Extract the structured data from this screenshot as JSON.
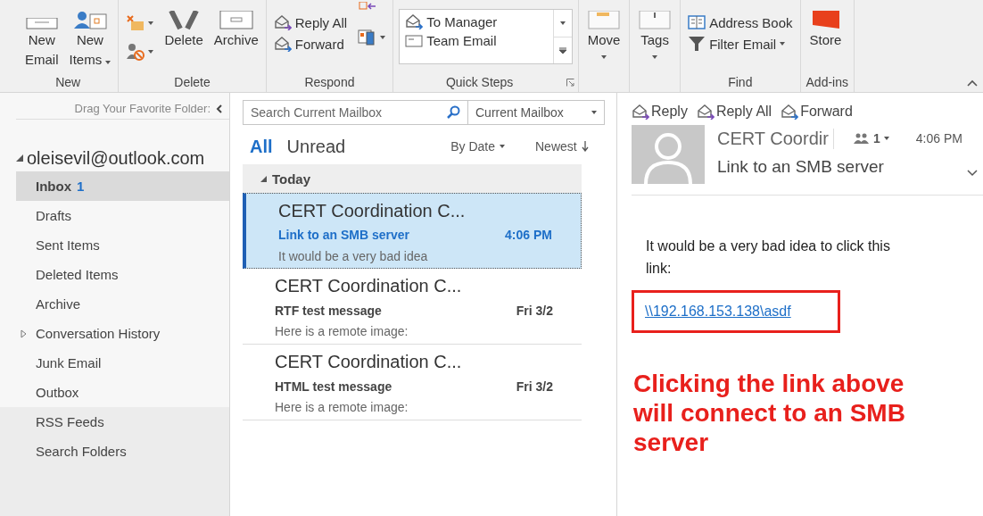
{
  "ribbon": {
    "groups": [
      {
        "label": "New",
        "buttons": [
          {
            "kind": "large",
            "lines": [
              "New",
              "Email"
            ],
            "dropdown": false
          },
          {
            "kind": "large",
            "lines": [
              "New",
              "Items"
            ],
            "dropdown": true
          }
        ]
      },
      {
        "label": "Delete",
        "buttons": [
          {
            "kind": "icons",
            "dropdown": true
          },
          {
            "kind": "large",
            "lines": [
              "Delete"
            ],
            "dropdown": false
          },
          {
            "kind": "large",
            "lines": [
              "Archive"
            ],
            "dropdown": false
          }
        ]
      },
      {
        "label": "Respond",
        "buttons": [
          {
            "kind": "small",
            "lines": [
              "Reply All"
            ],
            "dropdown": false
          },
          {
            "kind": "small",
            "lines": [
              "Forward"
            ],
            "dropdown": false
          },
          {
            "kind": "icons",
            "dropdown": true
          }
        ]
      },
      {
        "label": "Quick Steps",
        "buttons": [
          {
            "kind": "gallery",
            "lines": [
              "To Manager",
              "Team Email"
            ],
            "dropdown": true
          }
        ],
        "launcher": true
      },
      {
        "buttons": [
          {
            "kind": "large",
            "lines": [
              "Move"
            ],
            "dropdown": true
          }
        ]
      },
      {
        "buttons": [
          {
            "kind": "large",
            "lines": [
              "Tags"
            ],
            "dropdown": true
          }
        ]
      },
      {
        "label": "Find",
        "buttons": [
          {
            "kind": "small",
            "lines": [
              "Address Book"
            ],
            "dropdown": false
          },
          {
            "kind": "small",
            "lines": [
              "Filter Email"
            ],
            "dropdown": true
          }
        ]
      },
      {
        "label": "Add-ins",
        "buttons": [
          {
            "kind": "large",
            "lines": [
              "Store"
            ],
            "dropdown": false
          }
        ]
      }
    ]
  },
  "sidebar": {
    "favorites_hint": "Drag Your Favorite Folder:",
    "account": {
      "name": "oleisevil@outlook.com",
      "expanded": true
    },
    "folders": [
      {
        "name": "Inbox",
        "count": "1",
        "selected": true,
        "has_subfolders": false
      },
      {
        "name": "Drafts",
        "selected": false,
        "has_subfolders": false
      },
      {
        "name": "Sent Items",
        "selected": false,
        "has_subfolders": false
      },
      {
        "name": "Deleted Items",
        "selected": false,
        "has_subfolders": false
      },
      {
        "name": "Archive",
        "selected": false,
        "has_subfolders": false
      },
      {
        "name": "Conversation History",
        "selected": false,
        "has_subfolders": true
      },
      {
        "name": "Junk Email",
        "selected": false,
        "has_subfolders": false
      },
      {
        "name": "Outbox",
        "selected": false,
        "has_subfolders": false
      }
    ],
    "other_folders": [
      {
        "name": "RSS Feeds",
        "selected": false
      },
      {
        "name": "Search Folders",
        "selected": false
      }
    ]
  },
  "message_list": {
    "search": {
      "placeholder": "Search Current Mailbox"
    },
    "scope": "Current Mailbox",
    "filters": [
      {
        "label": "All",
        "selected": true
      },
      {
        "label": "Unread",
        "selected": false
      }
    ],
    "sort": "By Date",
    "order": "Newest",
    "group": {
      "label": "Today",
      "expanded": true
    },
    "messages": [
      {
        "sender": "CERT Coordination C...",
        "subject": "Link to an SMB server",
        "preview": "It would be a very bad idea",
        "time": "4:06 PM",
        "selected": true,
        "unread": true
      },
      {
        "sender": "CERT Coordination C...",
        "subject": "RTF test message",
        "preview": "Here is a remote image:",
        "time": "Fri 3/2",
        "selected": false,
        "unread": false
      },
      {
        "sender": "CERT Coordination C...",
        "subject": "HTML test message",
        "preview": "Here is a remote image:",
        "time": "Fri 3/2",
        "selected": false,
        "unread": false
      }
    ]
  },
  "reading_pane": {
    "actions": [
      "Reply",
      "Reply All",
      "Forward"
    ],
    "sender": "CERT Coordir",
    "people": "1",
    "time": "4:06 PM",
    "subject": "Link to an SMB server",
    "body": "It would be a very bad idea to click this link:",
    "link": "\\\\192.168.153.138\\asdf",
    "annotation": "Clicking the link above will connect to an SMB server"
  }
}
